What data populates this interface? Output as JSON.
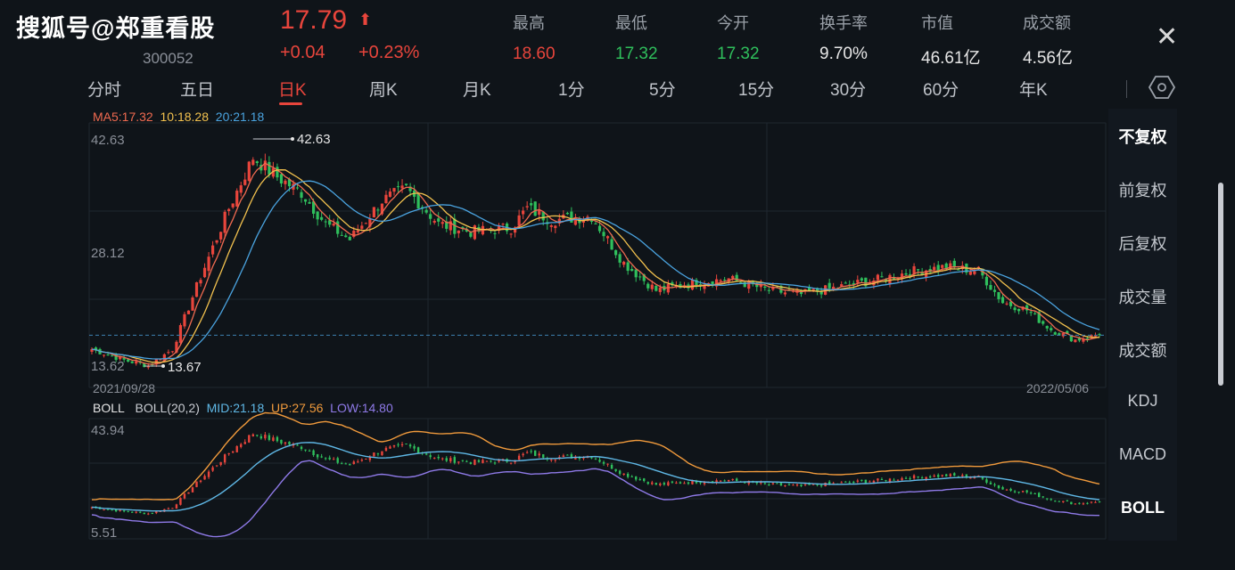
{
  "watermark": "搜狐号@郑重看股",
  "stock": {
    "code": "300052",
    "price": "17.79",
    "arrow": "⬆",
    "change": "+0.04",
    "change_pct": "+0.23%"
  },
  "stats": [
    {
      "label": "最高",
      "value": "18.60",
      "color": "#e8453c"
    },
    {
      "label": "最低",
      "value": "17.32",
      "color": "#2fbf5c"
    },
    {
      "label": "今开",
      "value": "17.32",
      "color": "#2fbf5c"
    },
    {
      "label": "换手率",
      "value": "9.70%",
      "color": "#e6e6e6"
    },
    {
      "label": "市值",
      "value": "46.61亿",
      "color": "#e6e6e6"
    },
    {
      "label": "成交额",
      "value": "4.56亿",
      "color": "#e6e6e6"
    }
  ],
  "close_icon": "close-icon",
  "tabs": [
    "分时",
    "五日",
    "日K",
    "周K",
    "月K",
    "1分",
    "5分",
    "15分",
    "30分",
    "60分",
    "年K"
  ],
  "active_tab": "日K",
  "settings_icon": "hexagon-settings-icon",
  "ma_legend": {
    "ma5": "MA5:17.32",
    "ma10": "10:18.28",
    "ma20": "20:21.18"
  },
  "boll_legend": {
    "name": "BOLL",
    "params": "BOLL(20,2)",
    "mid": "MID:21.18",
    "up": "UP:27.56",
    "low": "LOW:14.80"
  },
  "side_menu": [
    "不复权",
    "前复权",
    "后复权",
    "成交量",
    "成交额",
    "KDJ",
    "MACD",
    "BOLL"
  ],
  "side_active": [
    "不复权",
    "BOLL"
  ],
  "colors": {
    "up": "#e8453c",
    "down": "#2fbf5c",
    "ma5": "#f06a50",
    "ma10": "#f2c14e",
    "ma20": "#4aa3df",
    "boll_up": "#f09a3c",
    "boll_mid": "#5fb8e6",
    "boll_low": "#8f7ae8"
  },
  "chart_data": [
    {
      "type": "candlestick",
      "y_axis_labels": [
        "42.63",
        "28.12",
        "13.62"
      ],
      "annotations": {
        "high": "42.63",
        "low": "13.67"
      },
      "x_labels": {
        "start": "2021/09/28",
        "end": "2022/05/06"
      },
      "ylim": [
        13.62,
        42.63
      ],
      "anchors": [
        [
          0,
          16
        ],
        [
          8,
          14.6
        ],
        [
          14,
          13.9
        ],
        [
          20,
          16
        ],
        [
          26,
          24
        ],
        [
          34,
          34
        ],
        [
          40,
          40.5
        ],
        [
          46,
          38
        ],
        [
          52,
          36
        ],
        [
          58,
          32
        ],
        [
          64,
          30
        ],
        [
          72,
          35
        ],
        [
          78,
          36.5
        ],
        [
          86,
          32
        ],
        [
          94,
          31
        ],
        [
          104,
          31.5
        ],
        [
          108,
          34
        ],
        [
          114,
          32.5
        ],
        [
          124,
          33
        ],
        [
          132,
          27
        ],
        [
          140,
          23.5
        ],
        [
          150,
          24.5
        ],
        [
          158,
          25
        ],
        [
          168,
          23.5
        ],
        [
          176,
          23
        ],
        [
          186,
          24
        ],
        [
          196,
          25
        ],
        [
          204,
          26
        ],
        [
          212,
          26.5
        ],
        [
          220,
          26
        ],
        [
          226,
          22
        ],
        [
          232,
          21
        ],
        [
          238,
          18.5
        ],
        [
          244,
          17.2
        ],
        [
          250,
          17.8
        ]
      ],
      "ma_final": {
        "ma5": 17.32,
        "ma10": 18.28,
        "ma20": 21.18
      }
    },
    {
      "type": "bollinger",
      "y_axis_labels": [
        "43.94",
        "5.51"
      ],
      "ylim": [
        5.51,
        43.94
      ],
      "boll_final": {
        "mid": 21.18,
        "up": 27.56,
        "low": 14.8
      }
    }
  ]
}
